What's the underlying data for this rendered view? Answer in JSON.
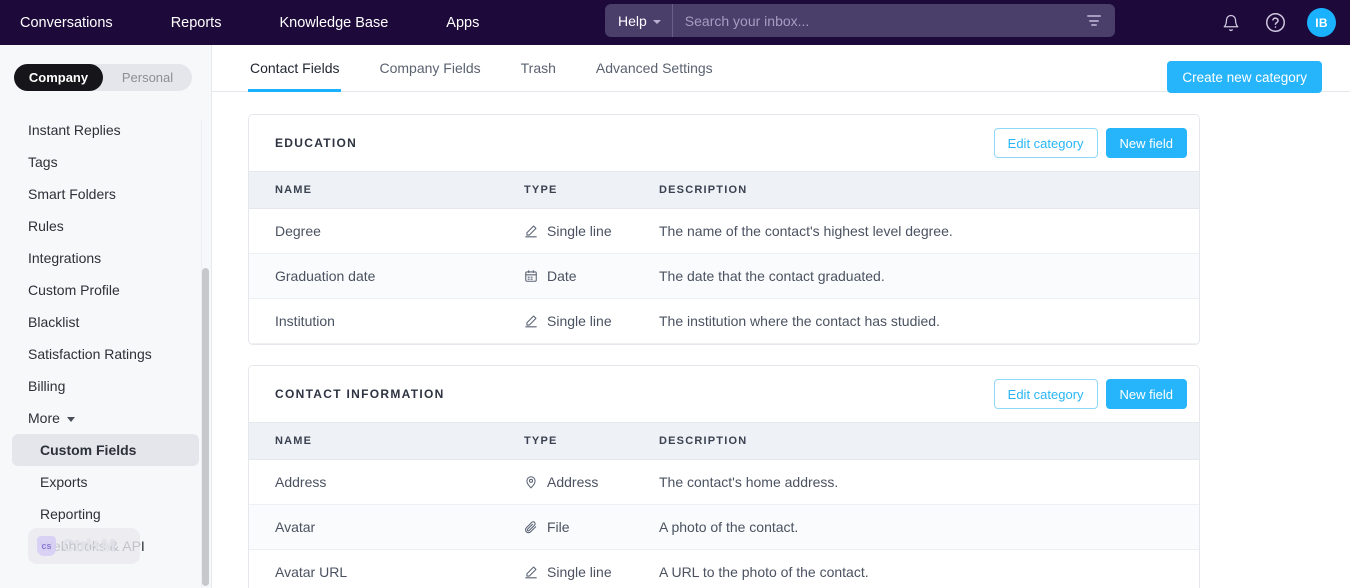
{
  "topnav": {
    "links": [
      {
        "label": "Conversations"
      },
      {
        "label": "Reports"
      },
      {
        "label": "Knowledge Base"
      },
      {
        "label": "Apps"
      }
    ],
    "help_label": "Help",
    "search_placeholder": "Search your inbox...",
    "search_value": "",
    "avatar_initials": "IB",
    "icons": {
      "filter": "filter-icon",
      "bell": "bell-icon",
      "help": "help-circle-icon",
      "caret": "chevron-down-icon"
    },
    "colors": {
      "background": "#1d0a3b",
      "search_bg": "#4a3e6b",
      "avatar_bg": "#1ab2ff"
    }
  },
  "sidebar": {
    "segmented": {
      "options": [
        {
          "label": "Company",
          "active": true
        },
        {
          "label": "Personal",
          "active": false
        }
      ]
    },
    "items": [
      {
        "label": "Instant Replies",
        "active": false,
        "sub": false,
        "chevron": false
      },
      {
        "label": "Tags",
        "active": false,
        "sub": false,
        "chevron": false
      },
      {
        "label": "Smart Folders",
        "active": false,
        "sub": false,
        "chevron": false
      },
      {
        "label": "Rules",
        "active": false,
        "sub": false,
        "chevron": false
      },
      {
        "label": "Integrations",
        "active": false,
        "sub": false,
        "chevron": false
      },
      {
        "label": "Custom Profile",
        "active": false,
        "sub": false,
        "chevron": false
      },
      {
        "label": "Blacklist",
        "active": false,
        "sub": false,
        "chevron": false
      },
      {
        "label": "Satisfaction Ratings",
        "active": false,
        "sub": false,
        "chevron": false
      },
      {
        "label": "Billing",
        "active": false,
        "sub": false,
        "chevron": false
      },
      {
        "label": "More",
        "active": false,
        "sub": false,
        "chevron": true
      },
      {
        "label": "Custom Fields",
        "active": true,
        "sub": true,
        "chevron": false
      },
      {
        "label": "Exports",
        "active": false,
        "sub": true,
        "chevron": false
      },
      {
        "label": "Reporting",
        "active": false,
        "sub": true,
        "chevron": false
      },
      {
        "label": "Webhooks & API",
        "active": false,
        "sub": true,
        "chevron": false
      }
    ]
  },
  "overlay_badge": {
    "logo_text": "cs",
    "shortcut": "Ctrl+M"
  },
  "main": {
    "tabs": [
      {
        "label": "Contact Fields",
        "active": true
      },
      {
        "label": "Company Fields",
        "active": false
      },
      {
        "label": "Trash",
        "active": false
      },
      {
        "label": "Advanced Settings",
        "active": false
      }
    ],
    "create_button": "Create new category",
    "columns": {
      "name": "NAME",
      "type": "TYPE",
      "description": "DESCRIPTION"
    },
    "buttons": {
      "edit_category": "Edit category",
      "new_field": "New field"
    },
    "categories": [
      {
        "title": "EDUCATION",
        "rows": [
          {
            "name": "Degree",
            "type": "Single line",
            "type_icon": "pencil-icon",
            "description": "The name of the contact's highest level degree."
          },
          {
            "name": "Graduation date",
            "type": "Date",
            "type_icon": "calendar-icon",
            "description": "The date that the contact graduated."
          },
          {
            "name": "Institution",
            "type": "Single line",
            "type_icon": "pencil-icon",
            "description": "The institution where the contact has studied."
          }
        ]
      },
      {
        "title": "CONTACT INFORMATION",
        "rows": [
          {
            "name": "Address",
            "type": "Address",
            "type_icon": "map-pin-icon",
            "description": "The contact's home address."
          },
          {
            "name": "Avatar",
            "type": "File",
            "type_icon": "paperclip-icon",
            "description": "A photo of the contact."
          },
          {
            "name": "Avatar URL",
            "type": "Single line",
            "type_icon": "pencil-icon",
            "description": "A URL to the photo of the contact."
          }
        ]
      }
    ]
  },
  "theme": {
    "accent": "#26b4fa",
    "header_bg": "#1d0a3b",
    "sidebar_bg": "#f7f8fa",
    "table_header_bg": "#eef1f5"
  }
}
